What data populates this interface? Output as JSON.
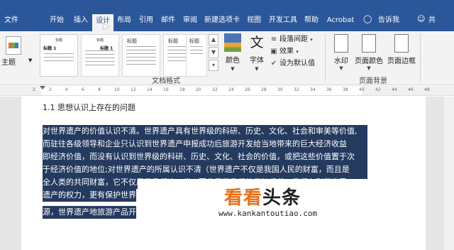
{
  "tabs": [
    {
      "label": "文件"
    },
    {
      "label": "开始"
    },
    {
      "label": "插入"
    },
    {
      "label": "设计"
    },
    {
      "label": "布局"
    },
    {
      "label": "引用"
    },
    {
      "label": "邮件"
    },
    {
      "label": "审阅"
    },
    {
      "label": "新建选项卡"
    },
    {
      "label": "视图"
    },
    {
      "label": "开发工具"
    },
    {
      "label": "帮助"
    },
    {
      "label": "Acrobat"
    },
    {
      "label": "告诉我"
    },
    {
      "label": "共"
    }
  ],
  "ribbon": {
    "theme_label": "主题",
    "theme_icon_text": "文文",
    "style_cards": [
      {
        "title": "标题",
        "subtitle": "标题 1"
      },
      {
        "title": "标题",
        "subtitle": "标题 1"
      },
      {
        "title": "标题",
        "subtitle": ""
      },
      {
        "title": "标题",
        "subtitle": ""
      },
      {
        "title": "标题",
        "subtitle": ""
      }
    ],
    "colors_label": "颜色",
    "fonts_label": "字体",
    "fonts_icon": "文",
    "paragraph_spacing_label": "段落间距",
    "effects_label": "效果",
    "set_default_label": "设为默认值",
    "group_document_format": "文档格式",
    "watermark_label": "水印",
    "page_color_label": "页面颜色",
    "page_border_label": "页面边框",
    "group_page_background": "页面背景",
    "accent_color": "#2b579a"
  },
  "ruler": {
    "ticks": [
      "2",
      "2",
      "4",
      "6",
      "8",
      "10",
      "12",
      "14",
      "16",
      "18",
      "20",
      "22",
      "24",
      "26",
      "28",
      "30",
      "32",
      "34",
      "36",
      "38",
      "40",
      "42",
      "44",
      "46",
      "48"
    ]
  },
  "document": {
    "heading": "1.1  思想认识上存在的问题",
    "lines": [
      "对世界遗产的价值认识不清。世界遗产具有世界级的科研、历史、文化、社会和审美等价值,",
      "而驻往各级领导和企业只认识到世界遗产申报成功后旅游开发给当地带来的巨大经济收益",
      "即经济价值，而没有认识到世界级的科研、历史、文化、社会的价值，或把这些价值置于次",
      "于经济价值的地位;对世界遗产的所属认识不清（世界遗产不仅是我国人民的财富，而且是",
      "全人类的共同财富，它不仅属于我们这一代，而且属于我们的子孙后代，我们有利用世界",
      "遗产的权力，更有保护世界",
      "源，世界遗产地旅游产品开"
    ]
  },
  "watermark": {
    "logo_orange": "看看",
    "logo_dark": "头条",
    "url": "www.kankantoutiao.com"
  }
}
